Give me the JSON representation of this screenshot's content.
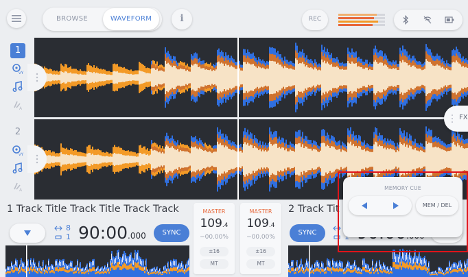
{
  "toolbar": {
    "menu_icon": "hamburger-menu-icon",
    "tabs": [
      {
        "label": "BROWSE",
        "active": false
      },
      {
        "label": "WAVEFORM",
        "active": true
      }
    ],
    "info_label": "i",
    "rec_label": "REC",
    "icons": [
      "bluetooth-icon",
      "no-signal-icon",
      "battery-icon"
    ]
  },
  "decks": [
    {
      "number": "1",
      "active": true,
      "title": "1 Track Title Track Title Track Track",
      "loop_top": "8",
      "loop_bottom": "1",
      "time_main": "90:00",
      "time_ms": ".000",
      "sync_label": "SYNC"
    },
    {
      "number": "2",
      "active": false,
      "title": "2 Track Tit",
      "loop_top": "8",
      "loop_bottom": "1",
      "time_main": "90:00",
      "time_ms": ".000",
      "sync_label": "SYNC"
    }
  ],
  "pitch": [
    {
      "master": "MASTER",
      "bpm": "109",
      "bpm_dec": ".4",
      "percent": "−00.00%",
      "range": "±16",
      "mt": "MT"
    },
    {
      "master": "MASTER",
      "bpm": "109",
      "bpm_dec": ".4",
      "percent": "−00.00%",
      "range": "±16",
      "mt": "MT"
    }
  ],
  "memory_cue": {
    "title": "MEMORY CUE",
    "prev_icon": "left-triangle-icon",
    "next_icon": "right-triangle-icon",
    "mem_del_label": "MEM / DEL"
  },
  "fx_label": "FX",
  "colors": {
    "accent": "#4a7fd6",
    "master": "#e7673a",
    "wave_orange": "#f39a27",
    "wave_blue": "#2f6fe0",
    "wave_cream": "#f7e3c6",
    "highlight": "#e0141a"
  }
}
